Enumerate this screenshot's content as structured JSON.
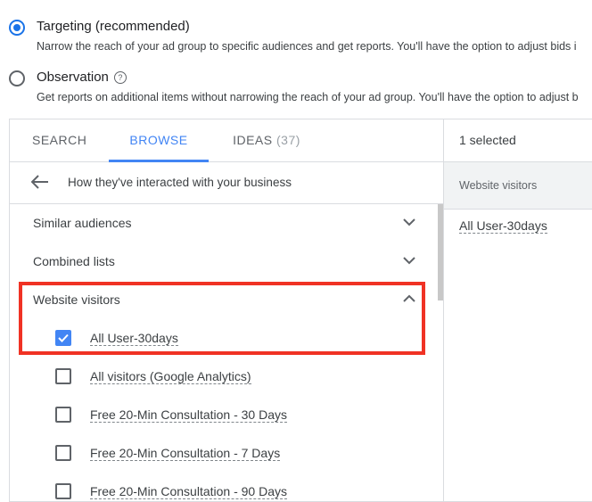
{
  "options": [
    {
      "title": "Targeting (recommended)",
      "description": "Narrow the reach of your ad group to specific audiences and get reports. You'll have the option to adjust bids i",
      "checked": true
    },
    {
      "title": "Observation",
      "description": "Get reports on additional items without narrowing the reach of your ad group. You'll have the option to adjust b",
      "checked": false,
      "help_icon": "help-circle-icon"
    }
  ],
  "tabs": {
    "search": "SEARCH",
    "browse": "BROWSE",
    "ideas": "IDEAS",
    "ideas_count": "(37)",
    "active": "browse"
  },
  "breadcrumb": {
    "back_icon": "arrow-left-icon",
    "label": "How they've interacted with your business"
  },
  "sections": {
    "similar": "Similar audiences",
    "combined": "Combined lists",
    "website": "Website visitors"
  },
  "items": [
    {
      "label": "All User-30days",
      "checked": true
    },
    {
      "label": "All visitors (Google Analytics)",
      "checked": false
    },
    {
      "label": "Free 20-Min Consultation - 30 Days",
      "checked": false
    },
    {
      "label": "Free 20-Min Consultation - 7 Days",
      "checked": false
    },
    {
      "label": "Free 20-Min Consultation - 90 Days",
      "checked": false
    }
  ],
  "selected_panel": {
    "count_label": "1 selected",
    "group_label": "Website visitors",
    "items": [
      "All User-30days"
    ]
  },
  "colors": {
    "accent": "#4285f4",
    "highlight": "#f03224"
  }
}
